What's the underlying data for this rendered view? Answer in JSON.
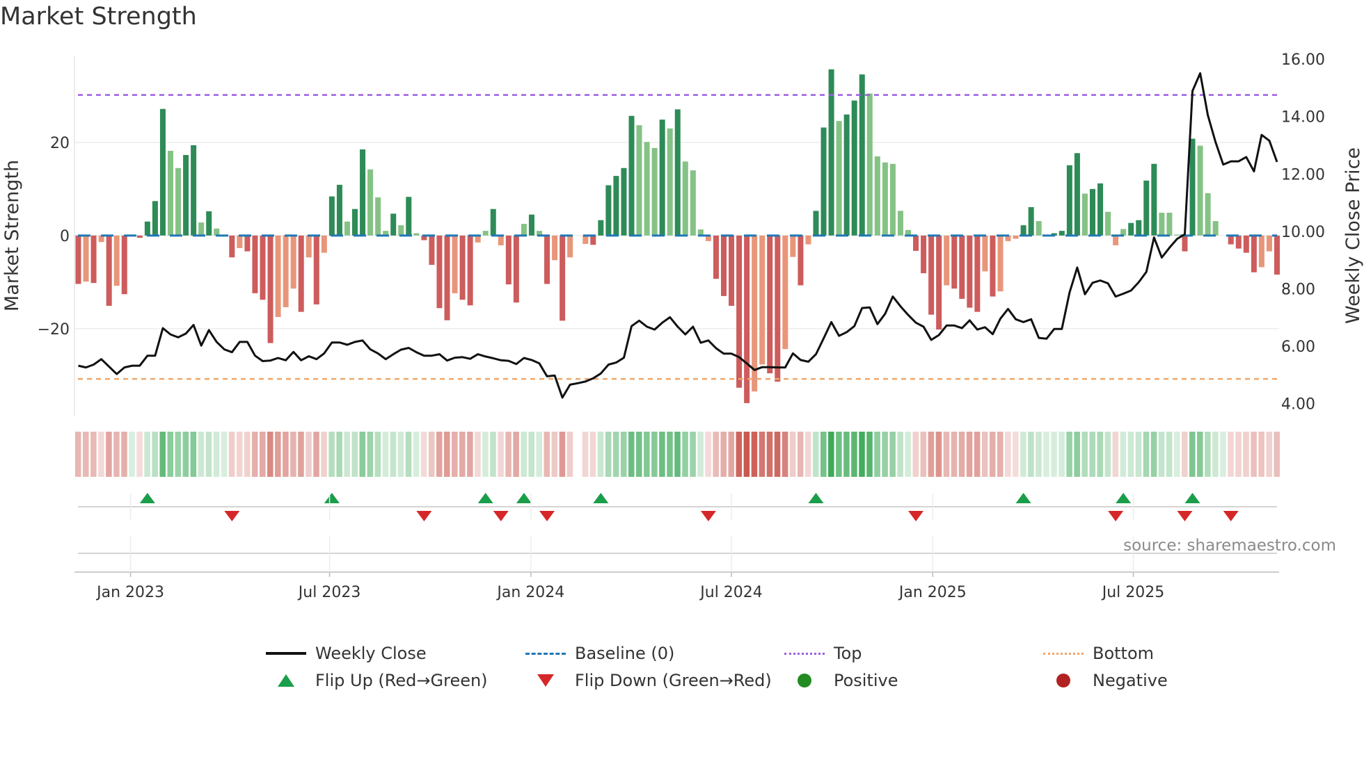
{
  "title": "Market Strength",
  "source": "source: sharemaestro.com",
  "legend": [
    {
      "label": "Weekly Close",
      "icon": "solid-line"
    },
    {
      "label": "Baseline (0)",
      "icon": "dashed-line"
    },
    {
      "label": "Top",
      "icon": "dotted-line-purple"
    },
    {
      "label": "Bottom",
      "icon": "dotted-line-orange"
    },
    {
      "label": "Flip Up (Red→Green)",
      "icon": "triangle-up"
    },
    {
      "label": "Flip Down (Green→Red)",
      "icon": "triangle-down"
    },
    {
      "label": "Positive",
      "icon": "green-dot"
    },
    {
      "label": "Negative",
      "icon": "red-dot"
    }
  ],
  "colors": {
    "strong_pos": "#2e8b57",
    "weak_pos": "#85c285",
    "strong_neg": "#cd5c5c",
    "weak_neg": "#e8967a",
    "price": "#111111",
    "baseline": "#1f77b4",
    "top": "#9b5fe0",
    "bottom": "#f0a56a",
    "flip_up": "#1a9e4a",
    "flip_down": "#d62728"
  },
  "chart_data": {
    "type": "bar+line",
    "title": "Market Strength",
    "ylabel": "Market Strength",
    "y2label": "Weekly Close Price",
    "ylim": [
      -38.7,
      38.5
    ],
    "y2lim": [
      3.58,
      16.1
    ],
    "y_ticks": [
      {
        "value": 20,
        "label": "20"
      },
      {
        "value": 0,
        "label": "0"
      },
      {
        "value": -20,
        "label": "−20"
      }
    ],
    "y2_ticks": [
      4,
      6,
      8,
      10,
      12,
      14,
      16
    ],
    "top_level": 30.2,
    "bottom_level": -30.8,
    "x_ticks": [
      {
        "label": "Jan 2023",
        "week": 6.8
      },
      {
        "label": "Jul 2023",
        "week": 32.7
      },
      {
        "label": "Jan 2024",
        "week": 58.9
      },
      {
        "label": "Jul 2024",
        "week": 85.0
      },
      {
        "label": "Jan 2025",
        "week": 111.2
      },
      {
        "label": "Jul 2025",
        "week": 137.3
      }
    ],
    "strength": [
      -10.4,
      -9.9,
      -10.2,
      -1.4,
      -15.1,
      -10.8,
      -12.6,
      0,
      -0.5,
      3.0,
      7.4,
      27.2,
      18.2,
      14.5,
      17.3,
      19.4,
      2.8,
      5.2,
      1.5,
      0.1,
      -4.7,
      -2.7,
      -3.4,
      -12.4,
      -13.8,
      -23.1,
      -17.5,
      -15.4,
      -11.4,
      -16.4,
      -4.7,
      -14.8,
      -3.7,
      8.4,
      10.9,
      3.0,
      5.7,
      18.5,
      14.2,
      8.2,
      1.0,
      4.7,
      2.2,
      8.3,
      0.5,
      -1.0,
      -6.3,
      -15.6,
      -18.2,
      -12.4,
      -13.8,
      -15.0,
      -1.5,
      1.0,
      5.7,
      -2.1,
      -10.5,
      -14.4,
      2.5,
      4.5,
      1.0,
      -10.4,
      -5.3,
      -18.3,
      -4.7,
      null,
      -1.8,
      -2.0,
      3.3,
      10.8,
      12.8,
      14.5,
      25.7,
      23.7,
      20.1,
      18.8,
      24.9,
      23.0,
      27.1,
      15.9,
      14.0,
      1.3,
      -1.2,
      -9.3,
      -13.0,
      -15.1,
      -32.7,
      -36.0,
      -33.5,
      -27.7,
      -29.6,
      -31.4,
      -24.4,
      -4.6,
      -10.7,
      -1.9,
      5.3,
      23.2,
      35.7,
      24.6,
      26.0,
      29.0,
      34.6,
      30.5,
      17.0,
      15.7,
      15.4,
      5.3,
      1.2,
      -3.3,
      -8.1,
      -17.0,
      -20.2,
      -10.7,
      -11.4,
      -13.6,
      -15.5,
      -16.4,
      -7.7,
      -13.1,
      -12.0,
      -1.2,
      -0.7,
      2.2,
      6.1,
      3.1,
      0.1,
      0.5,
      1.0,
      15.1,
      17.7,
      9.0,
      10.0,
      11.2,
      5.1,
      -2.1,
      1.4,
      2.7,
      3.3,
      11.8,
      15.4,
      4.9,
      4.9,
      0.2,
      -3.4,
      20.8,
      19.3,
      9.1,
      3.1,
      0,
      -1.9,
      -2.8,
      -3.7,
      -7.9,
      -6.8,
      -3.4,
      -8.4
    ],
    "weekly_close": [
      5.32,
      5.26,
      5.36,
      5.55,
      5.29,
      5.03,
      5.26,
      5.32,
      5.32,
      5.67,
      5.67,
      6.63,
      6.41,
      6.31,
      6.44,
      6.74,
      6.02,
      6.56,
      6.15,
      5.89,
      5.79,
      6.15,
      6.15,
      5.67,
      5.48,
      5.5,
      5.59,
      5.51,
      5.8,
      5.51,
      5.65,
      5.55,
      5.75,
      6.13,
      6.13,
      6.05,
      6.15,
      6.2,
      5.89,
      5.75,
      5.55,
      5.72,
      5.88,
      5.94,
      5.79,
      5.67,
      5.67,
      5.72,
      5.5,
      5.6,
      5.62,
      5.56,
      5.72,
      5.64,
      5.58,
      5.51,
      5.49,
      5.38,
      5.59,
      5.52,
      5.4,
      4.95,
      4.98,
      4.21,
      4.66,
      4.71,
      4.77,
      4.88,
      5.05,
      5.36,
      5.43,
      5.6,
      6.7,
      6.89,
      6.68,
      6.58,
      6.82,
      7.01,
      6.68,
      6.41,
      6.68,
      6.12,
      6.2,
      5.93,
      5.74,
      5.74,
      5.62,
      5.4,
      5.17,
      5.27,
      5.27,
      5.26,
      5.26,
      5.75,
      5.52,
      5.46,
      5.72,
      6.27,
      6.84,
      6.36,
      6.49,
      6.7,
      7.33,
      7.35,
      6.77,
      7.13,
      7.73,
      7.39,
      7.09,
      6.82,
      6.68,
      6.22,
      6.39,
      6.72,
      6.72,
      6.63,
      6.9,
      6.58,
      6.66,
      6.42,
      6.96,
      7.3,
      6.94,
      6.84,
      6.94,
      6.29,
      6.26,
      6.6,
      6.6,
      7.87,
      8.74,
      7.81,
      8.21,
      8.29,
      8.19,
      7.73,
      7.83,
      7.94,
      8.23,
      8.59,
      9.79,
      9.09,
      9.43,
      9.74,
      9.9,
      14.89,
      15.51,
      14.05,
      13.11,
      12.33,
      12.44,
      12.44,
      12.59,
      12.09,
      13.36,
      13.16,
      12.42
    ]
  }
}
